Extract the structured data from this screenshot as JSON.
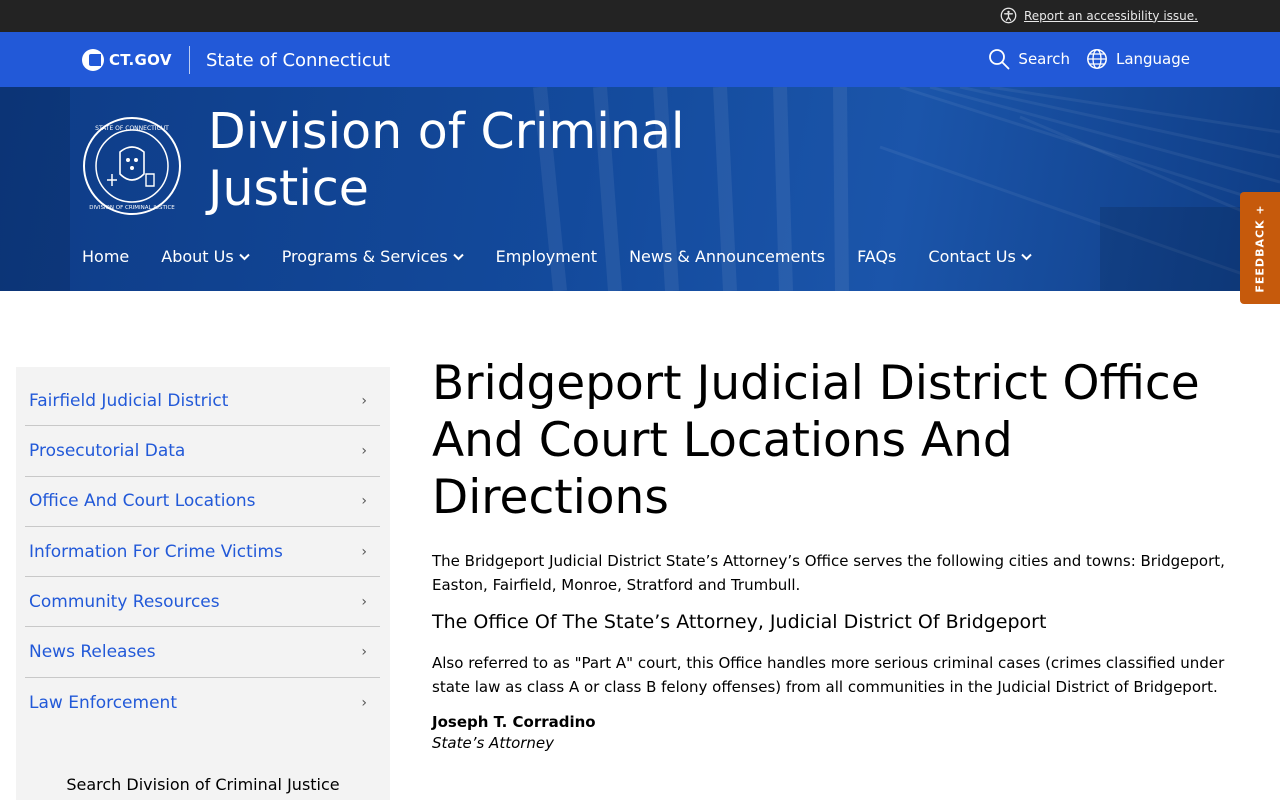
{
  "utility": {
    "accessibility_link": "Report an accessibility issue."
  },
  "gov_bar": {
    "logo_text": "CT.GOV",
    "state_name": "State of Connecticut",
    "search_label": "Search",
    "language_label": "Language"
  },
  "hero": {
    "title_line1": "Division of Criminal",
    "title_line2": "Justice",
    "seal_text": "STATE OF CONNECTICUT · DIVISION OF CRIMINAL JUSTICE"
  },
  "nav": {
    "items": [
      {
        "label": "Home",
        "dropdown": false
      },
      {
        "label": "About Us",
        "dropdown": true
      },
      {
        "label": "Programs & Services",
        "dropdown": true
      },
      {
        "label": "Employment",
        "dropdown": false
      },
      {
        "label": "News & Announcements",
        "dropdown": false
      },
      {
        "label": "FAQs",
        "dropdown": false
      },
      {
        "label": "Contact Us",
        "dropdown": true
      }
    ]
  },
  "feedback": {
    "label": "FEEDBACK +"
  },
  "sidebar": {
    "items": [
      {
        "label": "Fairfield Judicial District"
      },
      {
        "label": "Prosecutorial Data"
      },
      {
        "label": "Office And Court Locations"
      },
      {
        "label": "Information For Crime Victims"
      },
      {
        "label": "Community Resources"
      },
      {
        "label": "News Releases"
      },
      {
        "label": "Law Enforcement"
      }
    ],
    "arrow": "›",
    "search_heading": "Search Division of Criminal Justice"
  },
  "main": {
    "title": "Bridgeport Judicial District Office And Court Locations And Directions",
    "intro": "The Bridgeport Judicial District State’s Attorney’s Office serves the following cities and towns: Bridgeport, Easton, Fairfield, Monroe, Stratford and Trumbull.",
    "subheading": "The Office Of The State’s Attorney, Judicial District Of Bridgeport",
    "body": "Also referred to as \"Part A\" court, this Office handles more serious criminal cases (crimes classified under state law as class A or class B felony offenses) from all communities in the Judicial District of Bridgeport.",
    "person_name": "Joseph T. Corradino",
    "person_title": "State’s Attorney"
  },
  "colors": {
    "gov_blue": "#2259d8",
    "hero_blue": "#134a9c",
    "link_blue": "#2259d8",
    "feedback_orange": "#c65a0c"
  }
}
